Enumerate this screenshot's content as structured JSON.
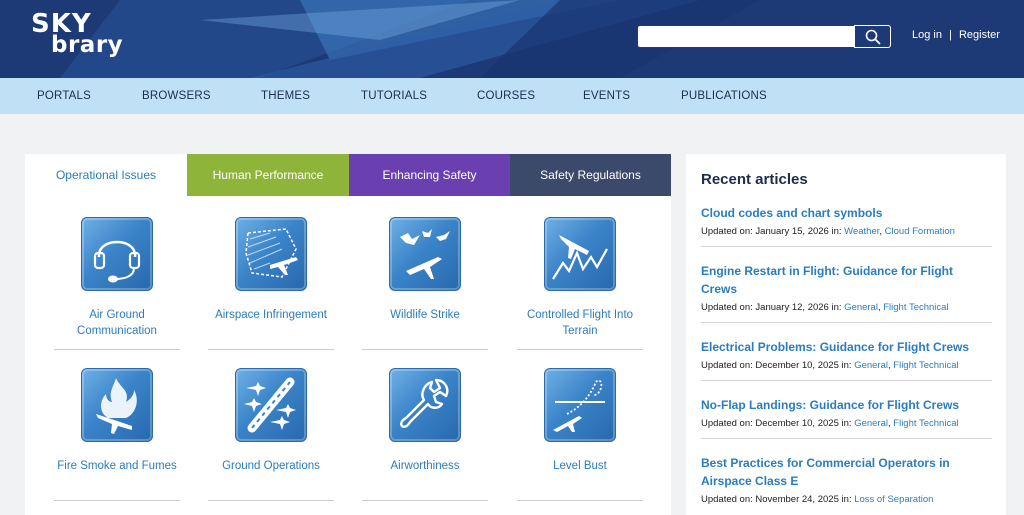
{
  "header": {
    "logo_line1": "SKY",
    "logo_line2": "brary",
    "search_placeholder": "",
    "login_label": "Log in",
    "separator": "|",
    "register_label": "Register",
    "colors": {
      "header_bg": "#1d3a76",
      "nav_bg": "#bfe0f5",
      "accent": "#2a7cbf"
    }
  },
  "nav": {
    "items": [
      "PORTALS",
      "BROWSERS",
      "THEMES",
      "TUTORIALS",
      "COURSES",
      "EVENTS",
      "PUBLICATIONS"
    ]
  },
  "tabs": [
    {
      "label": "Operational Issues",
      "color": "#ffffff"
    },
    {
      "label": "Human Performance",
      "color": "#8eb43a"
    },
    {
      "label": "Enhancing Safety",
      "color": "#6a3fb0"
    },
    {
      "label": "Safety Regulations",
      "color": "#3b4a6b"
    }
  ],
  "topics": [
    {
      "label": "Air Ground Communication",
      "icon": "headset-icon"
    },
    {
      "label": "Airspace Infringement",
      "icon": "airspace-infringement-icon"
    },
    {
      "label": "Wildlife Strike",
      "icon": "wildlife-strike-icon"
    },
    {
      "label": "Controlled Flight Into Terrain",
      "icon": "cfit-icon"
    },
    {
      "label": "Fire Smoke and Fumes",
      "icon": "fire-aircraft-icon"
    },
    {
      "label": "Ground Operations",
      "icon": "ground-operations-icon"
    },
    {
      "label": "Airworthiness",
      "icon": "wrench-icon"
    },
    {
      "label": "Level Bust",
      "icon": "level-bust-icon"
    }
  ],
  "recent": {
    "heading": "Recent articles",
    "updated_prefix": "Updated on:",
    "in_word": "in:",
    "articles": [
      {
        "title": "Cloud codes and chart symbols",
        "date": "January 15, 2026",
        "cats": [
          "Weather",
          "Cloud Formation"
        ]
      },
      {
        "title": "Engine Restart in Flight: Guidance for Flight Crews",
        "date": "January 12, 2026",
        "cats": [
          "General",
          "Flight Technical"
        ]
      },
      {
        "title": "Electrical Problems: Guidance for Flight Crews",
        "date": "December 10, 2025",
        "cats": [
          "General",
          "Flight Technical"
        ]
      },
      {
        "title": "No-Flap Landings: Guidance for Flight Crews",
        "date": "December 10, 2025",
        "cats": [
          "General",
          "Flight Technical"
        ]
      },
      {
        "title": "Best Practices for Commercial Operators in Airspace Class E",
        "date": "November 24, 2025",
        "cats": [
          "Loss of Separation"
        ]
      }
    ]
  }
}
